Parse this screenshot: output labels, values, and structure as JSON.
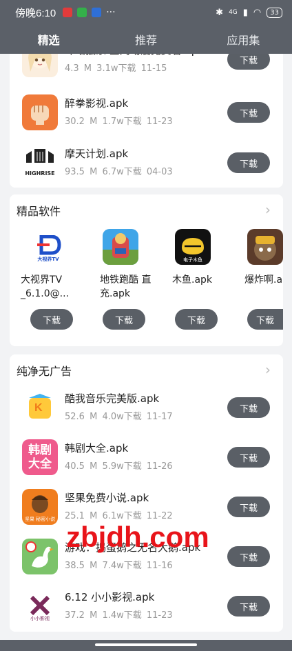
{
  "status": {
    "time": "傍晚6:10",
    "dots": "···",
    "battery": "33",
    "network": "4G"
  },
  "tabs": [
    {
      "label": "精选"
    },
    {
      "label": "推荐"
    },
    {
      "label": "应用集"
    }
  ],
  "top_list": [
    {
      "name": "咔咕独家 全网动漫免费看.apk",
      "size": "4.3 M",
      "downloads": "3.1w下载",
      "date": "11-15",
      "icon": "anime-girl-icon"
    },
    {
      "name": "醉拳影视.apk",
      "size": "30.2 M",
      "downloads": "1.7w下载",
      "date": "11-23",
      "icon": "fist-icon"
    },
    {
      "name": "摩天计划.apk",
      "size": "93.5 M",
      "downloads": "6.7w下载",
      "date": "04-03",
      "icon": "highrise-icon",
      "icon_text": "HIGHRISE"
    }
  ],
  "featured": {
    "title": "精品软件",
    "items": [
      {
        "name": "大视界TV _6.1.0@...",
        "icon": "tv-logo-icon",
        "icon_text": "大视界TV"
      },
      {
        "name": "地铁跑酷 直充.apk",
        "icon": "subway-icon"
      },
      {
        "name": "木鱼.apk",
        "icon": "woodfish-icon",
        "icon_text": "电子木鱼"
      },
      {
        "name": "爆炸啊.apk",
        "icon": "bomb-icon"
      }
    ]
  },
  "adfree": {
    "title": "纯净无广告",
    "items": [
      {
        "name": "酷我音乐完美版.apk",
        "size": "52.6 M",
        "downloads": "4.0w下载",
        "date": "11-17",
        "icon": "kuwo-icon",
        "icon_text": "K"
      },
      {
        "name": "韩剧大全.apk",
        "size": "40.5 M",
        "downloads": "5.9w下载",
        "date": "11-26",
        "icon": "korean-drama-icon",
        "icon_text": "韩剧大全"
      },
      {
        "name": "坚果免费小说.apk",
        "size": "25.1 M",
        "downloads": "6.1w下载",
        "date": "11-22",
        "icon": "nut-icon",
        "icon_text": "坚果 秘密小说"
      },
      {
        "name": "游戏：捣蛋鹅之无名大鹅.apk",
        "size": "38.5 M",
        "downloads": "7.4w下载",
        "date": "11-16",
        "icon": "goose-icon"
      },
      {
        "name": "6.12 小小影视.apk",
        "size": "37.2 M",
        "downloads": "1.4w下载",
        "date": "11-23",
        "icon": "film-icon",
        "icon_text": "小小影视"
      }
    ]
  },
  "download_label": "下载",
  "chevron": "›",
  "watermark": "zbjdh.com"
}
